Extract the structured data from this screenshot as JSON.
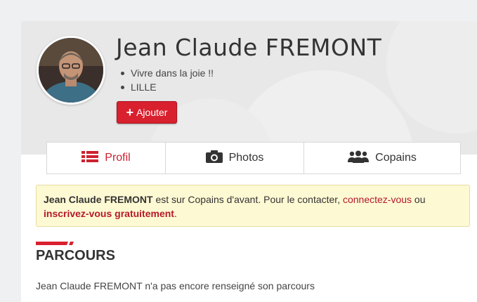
{
  "profile": {
    "name": "Jean Claude FREMONT",
    "bio": [
      "Vivre dans la joie !!",
      "LILLE"
    ],
    "add_button": "Ajouter"
  },
  "tabs": [
    {
      "label": "Profil",
      "icon": "list-icon",
      "active": true
    },
    {
      "label": "Photos",
      "icon": "camera-icon",
      "active": false
    },
    {
      "label": "Copains",
      "icon": "users-icon",
      "active": false
    }
  ],
  "notice": {
    "name": "Jean Claude FREMONT",
    "text1": " est sur Copains d'avant. Pour le contacter, ",
    "link1": "connectez-vous",
    "text2": " ou ",
    "link2": "inscrivez-vous gratuitement",
    "text3": "."
  },
  "section": {
    "title": "PARCOURS",
    "text": "Jean Claude FREMONT n'a pas encore renseigné son parcours"
  },
  "colors": {
    "accent": "#d9202e",
    "link": "#b5192a",
    "notice_bg": "#fdf9d3"
  }
}
